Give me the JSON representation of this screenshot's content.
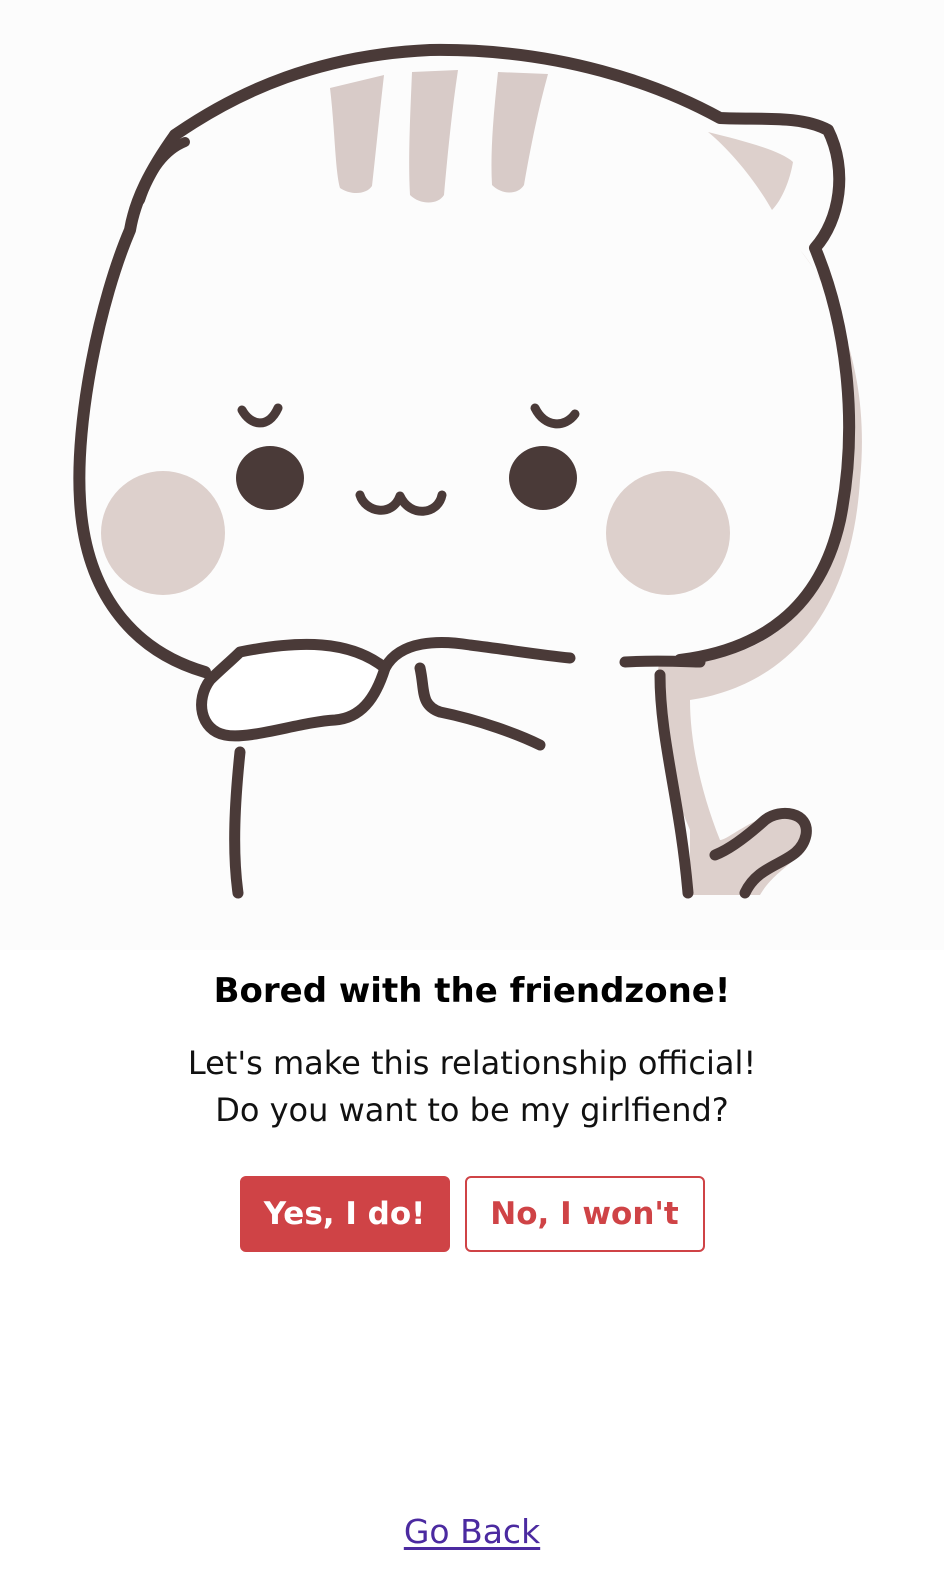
{
  "hero": {
    "image": "cute-cat-pleading-illustration"
  },
  "content": {
    "title": "Bored with the friendzone!",
    "message_line1": "Let's make this relationship official!",
    "message_line2": "Do you want to be my girlfiend?"
  },
  "buttons": {
    "yes_label": "Yes, I do!",
    "no_label": "No, I won't"
  },
  "footer": {
    "go_back_label": "Go Back"
  },
  "colors": {
    "accent": "#cf4346",
    "link": "#4b2aa0",
    "outline": "#4a3a38",
    "blush": "#ddd0cc",
    "stripe": "#d8cbc8"
  }
}
